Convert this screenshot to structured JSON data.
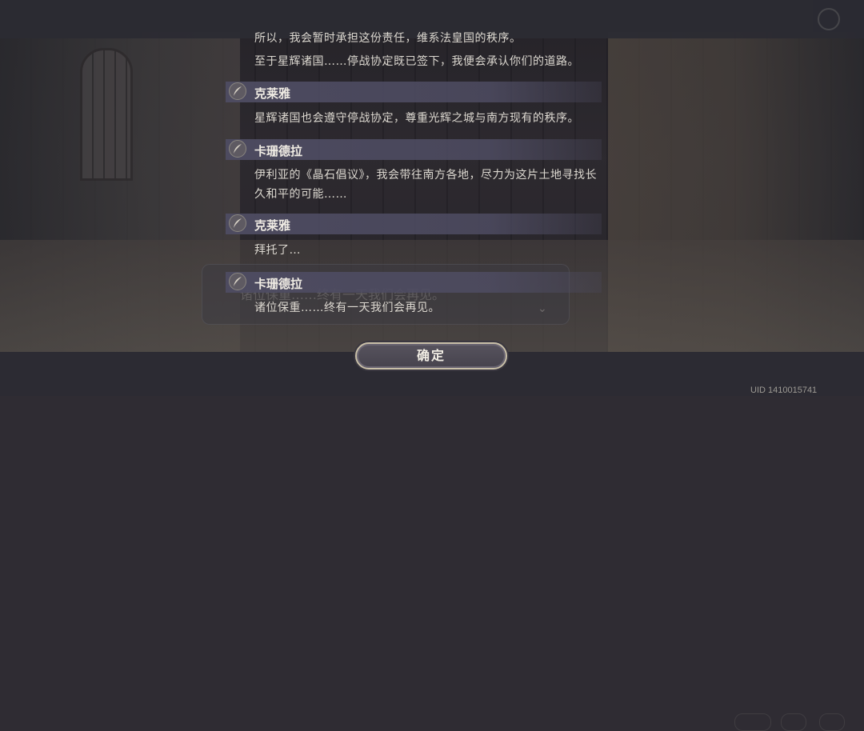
{
  "dialogue_log": {
    "entries": [
      {
        "speaker": "",
        "lines": [
          "所以，我会暂时承担这份责任，维系法皇国的秩序。"
        ]
      },
      {
        "speaker": "",
        "lines": [
          "至于星辉诸国……停战协定既已签下，我便会承认你们的道路。"
        ]
      },
      {
        "speaker": "克莱雅",
        "lines": [
          "星辉诸国也会遵守停战协定，尊重光辉之城与南方现有的秩序。"
        ]
      },
      {
        "speaker": "卡珊德拉",
        "lines": [
          "伊利亚的《晶石倡议》，我会带往南方各地，尽力为这片土地寻找长",
          "久和平的可能……"
        ]
      },
      {
        "speaker": "克莱雅",
        "lines": [
          "拜托了…"
        ]
      },
      {
        "speaker": "卡珊德拉",
        "lines": [
          "诸位保重……终有一天我们会再见。"
        ]
      }
    ]
  },
  "confirm_label": "确定",
  "uid_text": "UID 1410015741",
  "background_dialog_text": "诸位保重……终有一天我们会再见。",
  "icons": {
    "speaker": "quill-icon"
  },
  "colors": {
    "panel": "#4e4c62",
    "text": "#dcd8d0",
    "button_border": "#c8bfa8"
  }
}
